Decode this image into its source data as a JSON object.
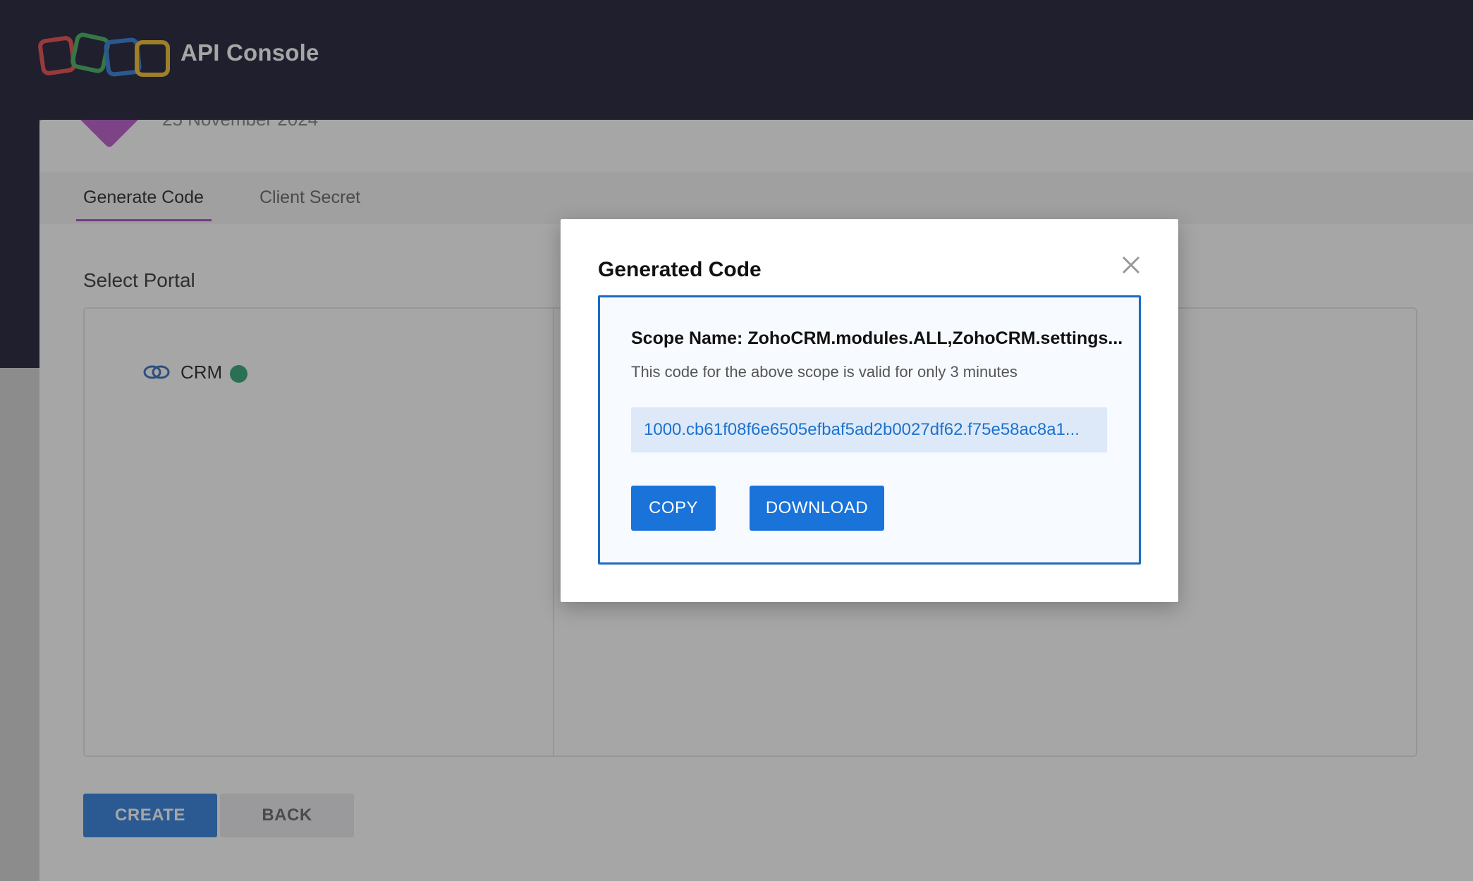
{
  "header": {
    "app_title": "API Console",
    "logo_colors": [
      "#e5383b",
      "#2fa84f",
      "#1f6fd6",
      "#f0b81a"
    ]
  },
  "client": {
    "date": "25 November 2024",
    "avatar_color": "#b349c6"
  },
  "tabs": [
    {
      "label": "Generate Code",
      "active": true
    },
    {
      "label": "Client Secret",
      "active": false
    }
  ],
  "portal": {
    "section_title": "Select Portal",
    "items": [
      {
        "label": "CRM",
        "status": "active",
        "status_color": "#1a9b66"
      }
    ]
  },
  "actions": {
    "create_label": "CREATE",
    "back_label": "BACK"
  },
  "modal": {
    "title": "Generated Code",
    "scope_line": "Scope Name: ZohoCRM.modules.ALL,ZohoCRM.settings...",
    "validity_text": "This code for the above scope is valid for only 3 minutes",
    "code_value": "1000.cb61f08f6e6505efbaf5ad2b0027df62.f75e58ac8a1...",
    "copy_label": "COPY",
    "download_label": "DOWNLOAD",
    "close_icon": "close-icon"
  }
}
